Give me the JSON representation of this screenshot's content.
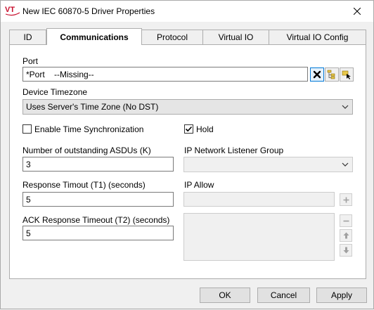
{
  "window": {
    "title": "New IEC 60870-5 Driver Properties",
    "app_icon_text": "VT",
    "accent_color": "#c8102e"
  },
  "tabs": [
    {
      "label": "ID",
      "active": false
    },
    {
      "label": "Communications",
      "active": true
    },
    {
      "label": "Protocol",
      "active": false
    },
    {
      "label": "Virtual IO",
      "active": false
    },
    {
      "label": "Virtual IO Config",
      "active": false
    }
  ],
  "form": {
    "port": {
      "label": "Port",
      "value": "*Port    --Missing--"
    },
    "device_timezone": {
      "label": "Device Timezone",
      "value": "Uses Server's Time Zone (No DST)"
    },
    "enable_time_sync": {
      "label": "Enable Time Synchronization",
      "checked": false
    },
    "hold": {
      "label": "Hold",
      "checked": true
    },
    "outstanding_asdus": {
      "label": "Number of outstanding ASDUs (K)",
      "value": "3"
    },
    "ip_listener_group": {
      "label": "IP Network Listener Group",
      "value": ""
    },
    "response_timeout": {
      "label": "Response Timout (T1) (seconds)",
      "value": "5"
    },
    "ip_allow": {
      "label": "IP Allow",
      "value": ""
    },
    "ack_timeout": {
      "label": "ACK Response Timeout (T2) (seconds)",
      "value": "5"
    }
  },
  "buttons": {
    "ok": "OK",
    "cancel": "Cancel",
    "apply": "Apply"
  }
}
